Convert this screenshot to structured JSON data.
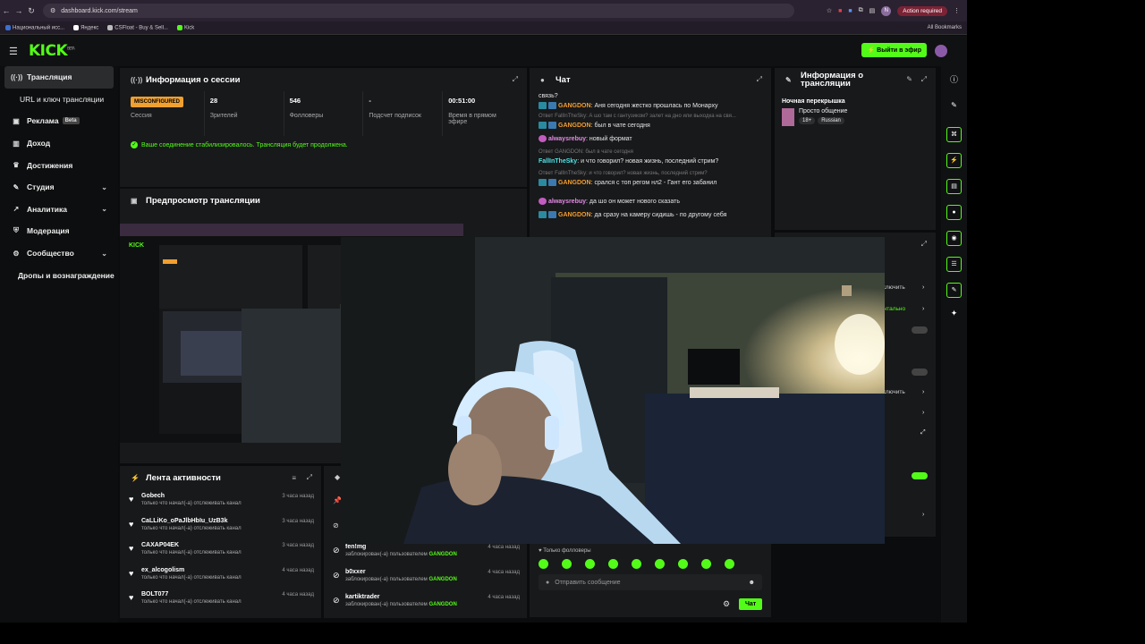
{
  "browser": {
    "url": "dashboard.kick.com/stream",
    "action_required": "Action required",
    "profile_initial": "N",
    "bookmarks": [
      "Национальный исс...",
      "Яндекс",
      "CSFloat - Buy & Sell...",
      "Kick"
    ],
    "all_bookmarks": "All Bookmarks"
  },
  "header": {
    "logo": "KICK",
    "logo_sup": "BETA",
    "go_live": "Выйти в эфир"
  },
  "sidebar": {
    "items": [
      {
        "label": "Трансляция",
        "icon": "broadcast-icon"
      },
      {
        "label": "URL и ключ трансляции",
        "icon": ""
      },
      {
        "label": "Реклама",
        "icon": "ads-icon",
        "badge": "Beta"
      },
      {
        "label": "Доход",
        "icon": "chart-icon"
      },
      {
        "label": "Достижения",
        "icon": "trophy-icon"
      },
      {
        "label": "Студия",
        "icon": "studio-icon"
      },
      {
        "label": "Аналитика",
        "icon": "analytics-icon"
      },
      {
        "label": "Модерация",
        "icon": "shield-icon"
      },
      {
        "label": "Сообщество",
        "icon": "community-icon"
      },
      {
        "label": "Дропы и вознаграждение",
        "icon": ""
      }
    ]
  },
  "session": {
    "title": "Информация о сессии",
    "status_badge": "MISCONFIGURED",
    "stats": [
      {
        "value": "",
        "label": "Сессия"
      },
      {
        "value": "28",
        "label": "Зрителей"
      },
      {
        "value": "546",
        "label": "Фолловеры"
      },
      {
        "value": "-",
        "label": "Подсчет подписок"
      },
      {
        "value": "00:51:00",
        "label": "Время в прямом эфире"
      }
    ],
    "message": "Ваше соединение стабилизировалось. Трансляция будет продолжена."
  },
  "preview": {
    "title": "Предпросмотр трансляции"
  },
  "chat": {
    "title": "Чат",
    "top_fragment": "связь?",
    "lines": [
      {
        "reply": "",
        "user": "GANGDON",
        "color": "orange",
        "badges": 2,
        "text": ": Аня сегодня жестко прошлась по Монарху"
      },
      {
        "reply": "Ответ FallInTheSky: А шо там с гантузиком? залет на дно или выходка на свя...",
        "user": "GANGDON",
        "color": "orange",
        "badges": 2,
        "text": ": был в чате сегодня"
      },
      {
        "reply": "",
        "user": "alwaysrebuy",
        "color": "pink",
        "badges": 1,
        "text": ": новый формат"
      },
      {
        "reply": "Ответ GANGDON: был в чате сегодня",
        "user": "FallInTheSky",
        "color": "cyan",
        "badges": 0,
        "text": ": и что говорил? новая жизнь, последний стрим?"
      },
      {
        "reply": "Ответ FallInTheSky: и что говорил? новая жизнь, последний стрим?",
        "user": "GANGDON",
        "color": "orange",
        "badges": 2,
        "text": ": срался с топ регом нл2 - Гант его забанил"
      },
      {
        "reply": "",
        "user": "alwaysrebuy",
        "color": "pink",
        "badges": 1,
        "text": ": да шо он может нового сказать"
      },
      {
        "reply": "",
        "user": "GANGDON",
        "color": "orange",
        "badges": 2,
        "text": ": да сразу на камеру сидишь - по другому себя"
      }
    ],
    "followers_only": "Только фолловеры",
    "input_placeholder": "Отправить сообщение",
    "send_label": "Чат"
  },
  "stream_info": {
    "title": "Информация о трансляции",
    "stream_title": "Ночная перекрышка",
    "category": "Просто общение",
    "tags": [
      "18+",
      "Russian"
    ]
  },
  "hidden_controls": {
    "labels": [
      "тключить",
      "ентально",
      "тключить"
    ]
  },
  "activity": {
    "title": "Лента активности",
    "rows": [
      {
        "name": "Gobech",
        "desc": "только что начал(-а) отслеживать канал",
        "time": "3 часа назад"
      },
      {
        "name": "CaLLiKo_oPaJlbHbIu_UzB3k",
        "desc": "только что начал(-а) отслеживать канал",
        "time": "3 часа назад"
      },
      {
        "name": "CAXAP04EK",
        "desc": "только что начал(-а) отслеживать канал",
        "time": "3 часа назад"
      },
      {
        "name": "ex_alcogolism",
        "desc": "только что начал(-а) отслеживать канал",
        "time": "4 часа назад"
      },
      {
        "name": "BOLT077",
        "desc": "только что начал(-а) отслеживать канал",
        "time": "4 часа назад"
      }
    ]
  },
  "moderation": {
    "rows": [
      {
        "name": "fen!mg",
        "desc": "заблокирован(-а) пользователем",
        "by": "GANGDON",
        "time": "4 часа назад"
      },
      {
        "name": "b0xxer",
        "desc": "заблокирован(-а) пользователем",
        "by": "GANGDON",
        "time": "4 часа назад"
      },
      {
        "name": "kartiktrader",
        "desc": "заблокирован(-а) пользователем",
        "by": "GANGDON",
        "time": "4 часа назад"
      }
    ]
  },
  "colors": {
    "accent": "#53fc18",
    "panel": "#18191b",
    "warning": "#f0a030"
  }
}
